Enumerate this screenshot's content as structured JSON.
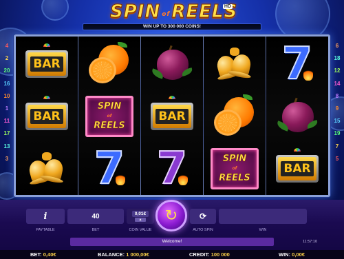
{
  "game": {
    "logo_word1": "SPIN",
    "logo_of": "of",
    "logo_word2": "REELS",
    "logo_badge": "HD",
    "win_banner": "WIN UP TO 300 000 COINS!"
  },
  "paylines_left": [
    "4",
    "2",
    "20",
    "16",
    "10",
    "1",
    "11",
    "17",
    "13",
    "3"
  ],
  "paylines_right": [
    "6",
    "18",
    "12",
    "14",
    "8",
    "9",
    "15",
    "19",
    "7",
    "5"
  ],
  "reels": [
    [
      "bar",
      "bar",
      "bells"
    ],
    [
      "orange",
      "spin_of_reels",
      "seven_blue"
    ],
    [
      "plum",
      "bar",
      "seven_purple"
    ],
    [
      "bells",
      "orange",
      "spin_of_reels"
    ],
    [
      "seven_blue",
      "plum",
      "bar"
    ]
  ],
  "symbol_text": {
    "bar": "BAR",
    "seven": "7",
    "sor_top": "SPIN",
    "sor_of": "of",
    "sor_bottom": "REELS"
  },
  "controls": {
    "paytable_icon": "i",
    "paytable_label": "PAYTABLE",
    "bet_value": "40",
    "bet_label": "BET",
    "coin_value": "0,01€",
    "coin_value_label": "COIN VALUE",
    "coin_up_icon": "▲",
    "spin_icon": "↻",
    "autospin_icon": "⟳",
    "autospin_label": "AUTO SPIN",
    "win_label": "WIN",
    "win_value": ""
  },
  "message": "Welcome!",
  "clock": "11:57:10",
  "status": {
    "bet_label": "BET:",
    "bet_value": "0,40€",
    "balance_label": "BALANCE:",
    "balance_value": "1 000,00€",
    "credit_label": "CREDIT:",
    "credit_value": "100 000",
    "win_label": "WIN:",
    "win_value": "0,00€"
  },
  "colors": {
    "accent_gold": "#ffd54a",
    "panel_purple": "#3c2a7a",
    "background_blue": "#1530a8"
  }
}
